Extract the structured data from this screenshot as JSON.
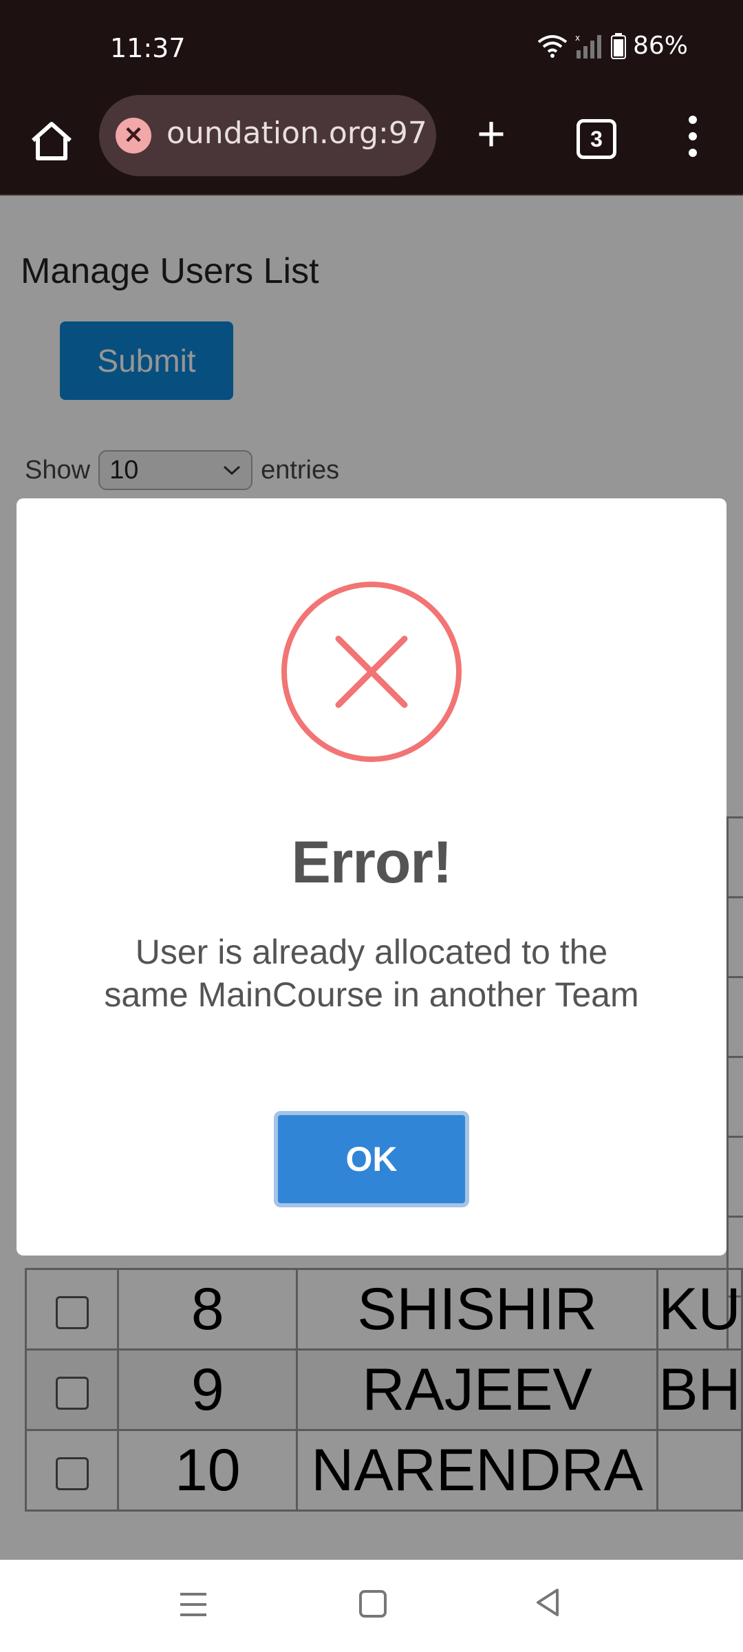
{
  "status_bar": {
    "time": "11:37",
    "battery": "86%"
  },
  "browser": {
    "url": "oundation.org:97",
    "tab_count": "3",
    "new_tab": "+"
  },
  "page": {
    "title": "Manage Users List",
    "submit_label": "Submit",
    "show_label": "Show",
    "entries_value": "10",
    "entries_label": "entries",
    "table_rows": [
      {
        "num": "8",
        "name": "SHISHIR",
        "last": "KU"
      },
      {
        "num": "9",
        "name": "RAJEEV",
        "last": "BH"
      },
      {
        "num": "10",
        "name": "NARENDRA",
        "last": ""
      }
    ]
  },
  "dialog": {
    "title": "Error!",
    "message": "User is already allocated to the same MainCourse in another Team",
    "ok_label": "OK",
    "icon": "error-x-icon",
    "icon_color": "#f27474",
    "button_color": "#3085d6"
  },
  "nav_bar": {
    "recent": "recent-apps-icon",
    "home": "home-icon",
    "back": "back-icon"
  }
}
